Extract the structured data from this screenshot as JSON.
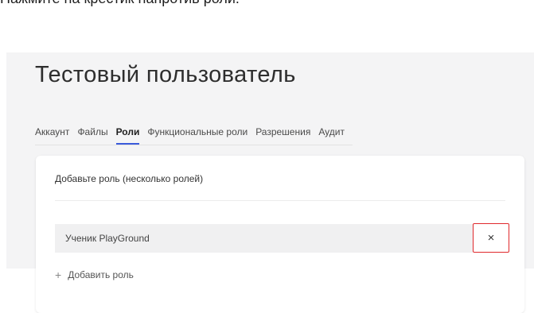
{
  "instruction": "Нажмите на крестик напротив роли.",
  "page": {
    "title": "Тестовый пользователь"
  },
  "tabs": [
    {
      "label": "Аккаунт",
      "active": false
    },
    {
      "label": "Файлы",
      "active": false
    },
    {
      "label": "Роли",
      "active": true
    },
    {
      "label": "Функциональные роли",
      "active": false
    },
    {
      "label": "Разрешения",
      "active": false
    },
    {
      "label": "Аудит",
      "active": false
    }
  ],
  "roles_card": {
    "heading": "Добавьте роль (несколько ролей)",
    "roles": [
      {
        "name": "Ученик PlayGround"
      }
    ],
    "remove_icon": "×",
    "add_icon": "+",
    "add_label": "Добавить роль"
  },
  "colors": {
    "highlight_border": "#e0292c",
    "active_tab_underline": "#3b5bdb"
  }
}
